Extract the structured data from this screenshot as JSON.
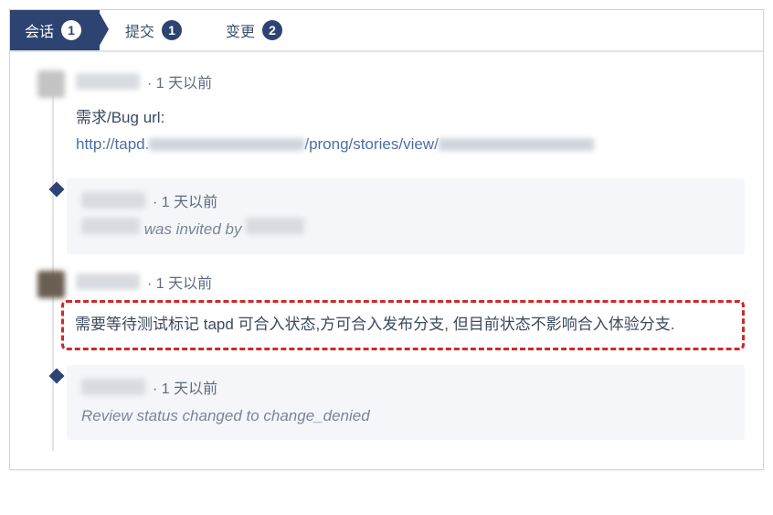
{
  "tabs": [
    {
      "label": "会话",
      "count": "1"
    },
    {
      "label": "提交",
      "count": "1"
    },
    {
      "label": "变更",
      "count": "2"
    }
  ],
  "entries": {
    "e1": {
      "time": "· 1 天以前",
      "label": "需求/Bug url:",
      "url_prefix": "http://tapd.",
      "url_mid": "/prong/stories/view/"
    },
    "e2": {
      "time": "· 1 天以前",
      "body_mid": " was invited by "
    },
    "e3": {
      "time": "· 1 天以前",
      "body": "需要等待测试标记 tapd 可合入状态,方可合入发布分支, 但目前状态不影响合入体验分支."
    },
    "e4": {
      "time": "· 1 天以前",
      "body": "Review status changed to change_denied"
    }
  }
}
